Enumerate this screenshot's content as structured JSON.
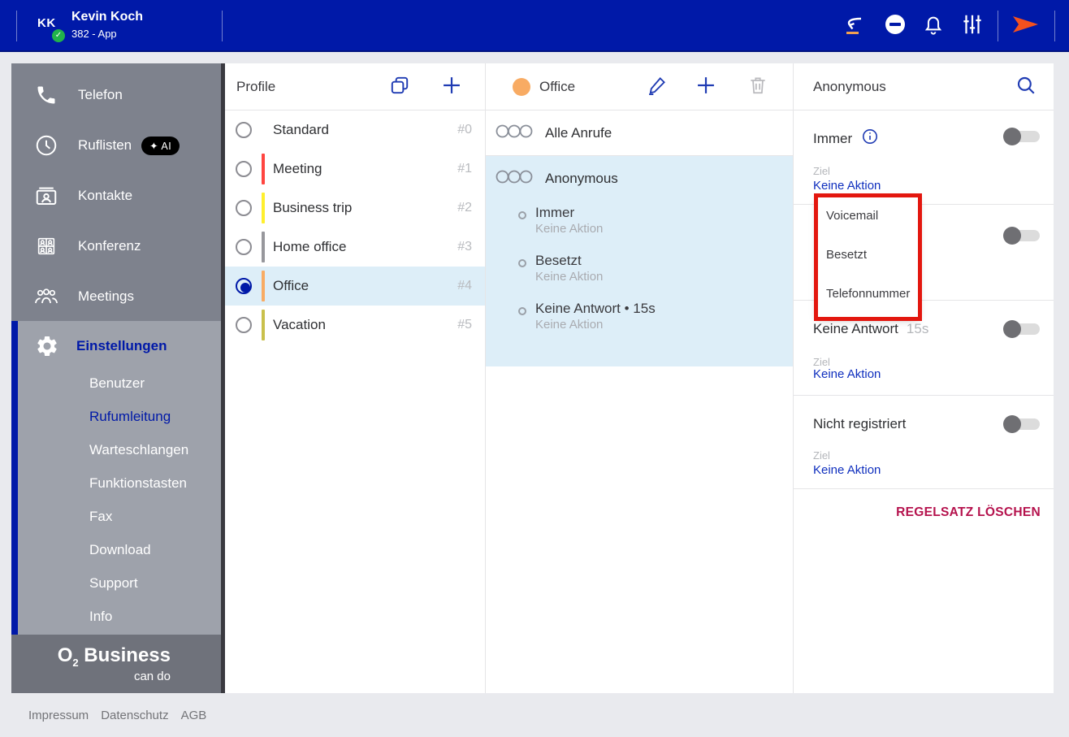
{
  "topbar": {
    "initials": "KK",
    "user_name": "Kevin Koch",
    "user_line": "382 - App"
  },
  "sidebar": {
    "items": [
      {
        "label": "Telefon",
        "icon": "phone-icon"
      },
      {
        "label": "Ruflisten",
        "icon": "clock-icon",
        "badge": "✦ AI"
      },
      {
        "label": "Kontakte",
        "icon": "contact-card-icon"
      },
      {
        "label": "Konferenz",
        "icon": "conference-grid-icon"
      },
      {
        "label": "Meetings",
        "icon": "people-icon"
      }
    ],
    "settings_label": "Einstellungen",
    "settings_items": [
      "Benutzer",
      "Rufumleitung",
      "Warteschlangen",
      "Funktionstasten",
      "Fax",
      "Download",
      "Support",
      "Info"
    ],
    "active_settings_item": "Rufumleitung",
    "logo_main": "O",
    "logo_sub": "2",
    "logo_rest": " Business",
    "logo_tagline": "can do"
  },
  "profiles": {
    "title": "Profile",
    "items": [
      {
        "name": "Standard",
        "number": "#0",
        "color": "",
        "selected": false
      },
      {
        "name": "Meeting",
        "number": "#1",
        "color": "#ff4540",
        "selected": false
      },
      {
        "name": "Business trip",
        "number": "#2",
        "color": "#ffef2e",
        "selected": false
      },
      {
        "name": "Home office",
        "number": "#3",
        "color": "#97979c",
        "selected": false
      },
      {
        "name": "Office",
        "number": "#4",
        "color": "#f8ab63",
        "selected": true
      },
      {
        "name": "Vacation",
        "number": "#5",
        "color": "#c9c04c",
        "selected": false
      }
    ]
  },
  "rules": {
    "title": "Office",
    "title_color": "#f8ab63",
    "all_calls_label": "Alle Anrufe",
    "selected_rule": "Anonymous",
    "conditions": [
      {
        "title": "Immer",
        "action": "Keine Aktion"
      },
      {
        "title": "Besetzt",
        "action": "Keine Aktion"
      },
      {
        "title": "Keine Antwort • 15s",
        "action": "Keine Aktion"
      }
    ]
  },
  "detail": {
    "title": "Anonymous",
    "immer": {
      "label": "Immer",
      "ziel": "Ziel",
      "action": "Keine Aktion",
      "toggle": "off"
    },
    "besetzt": {
      "toggle": "off"
    },
    "keine_antwort": {
      "label": "Keine Antwort",
      "duration": "15s",
      "ziel": "Ziel",
      "action": "Keine Aktion",
      "toggle": "off"
    },
    "nicht_registriert": {
      "label": "Nicht registriert",
      "ziel": "Ziel",
      "action": "Keine Aktion",
      "toggle": "off"
    },
    "delete_label": "REGELSATZ LÖSCHEN"
  },
  "dropdown": {
    "options": [
      "Voicemail",
      "Besetzt",
      "Telefonnummer"
    ]
  },
  "annotation": {
    "color": "#e3170f"
  },
  "footer": {
    "links": [
      "Impressum",
      "Datenschutz",
      "AGB"
    ]
  },
  "colors": {
    "topbar_blue": "#0019a8",
    "link_blue": "#0f2fbe",
    "selection_blue": "#ddeef8",
    "delete_red": "#b5124d",
    "sidebar_gray": "#7e828d",
    "settings_gray": "#9ea2ab"
  }
}
